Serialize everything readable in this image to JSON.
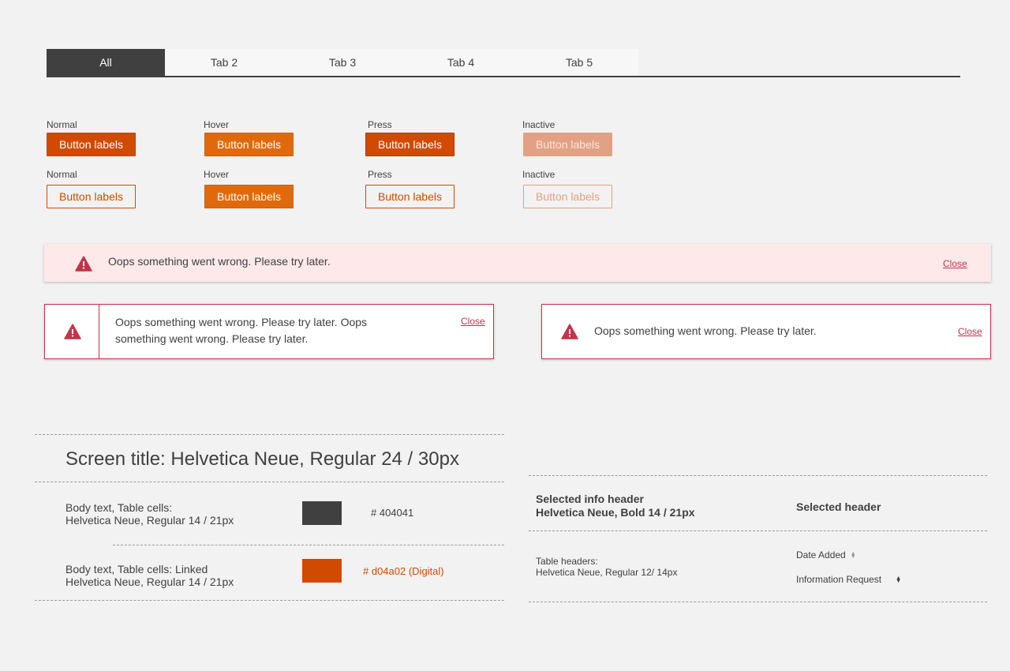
{
  "tabs": [
    {
      "label": "All",
      "active": true
    },
    {
      "label": "Tab 2",
      "active": false
    },
    {
      "label": "Tab 3",
      "active": false
    },
    {
      "label": "Tab 4",
      "active": false
    },
    {
      "label": "Tab 5",
      "active": false
    }
  ],
  "button_states": {
    "normal": "Normal",
    "hover": "Hover",
    "press": "Press",
    "inactive": "Inactive"
  },
  "button_label": "Button labels",
  "alerts": {
    "message": "Oops something went wrong. Please try later.",
    "message_long": "Oops something went wrong. Please try later. Oops something went wrong. Please try later.",
    "close_label": "Close"
  },
  "typography": {
    "screen_title": "Screen title: Helvetica Neue, Regular 24 / 30px",
    "body_label_1": "Body text, Table cells:",
    "body_spec_1": "Helvetica Neue, Regular 14 / 21px",
    "body_label_2": "Body text, Table cells: Linked",
    "body_spec_2": "Helvetica Neue, Regular 14 / 21px",
    "hex_dark": "# 404041",
    "hex_orange": "# d04a02 (Digital)",
    "selected_info_header": "Selected info header",
    "selected_info_spec": "Helvetica Neue, Bold 14 / 21px",
    "selected_header": "Selected header",
    "table_headers_label": "Table headers:",
    "table_headers_spec": "Helvetica Neue, Regular 12/ 14px",
    "col_date_added": "Date Added",
    "col_information_request": "Information Request"
  },
  "colors": {
    "primary_dark": "#404041",
    "accent_orange": "#d04a02",
    "hover_orange": "#e06a0b",
    "inactive_orange": "#e3a183",
    "alert_red": "#c5334a",
    "alert_background": "#fde9ea"
  },
  "icons": {
    "warning": "warning-triangle-icon",
    "sort": "sort-arrows-icon"
  }
}
